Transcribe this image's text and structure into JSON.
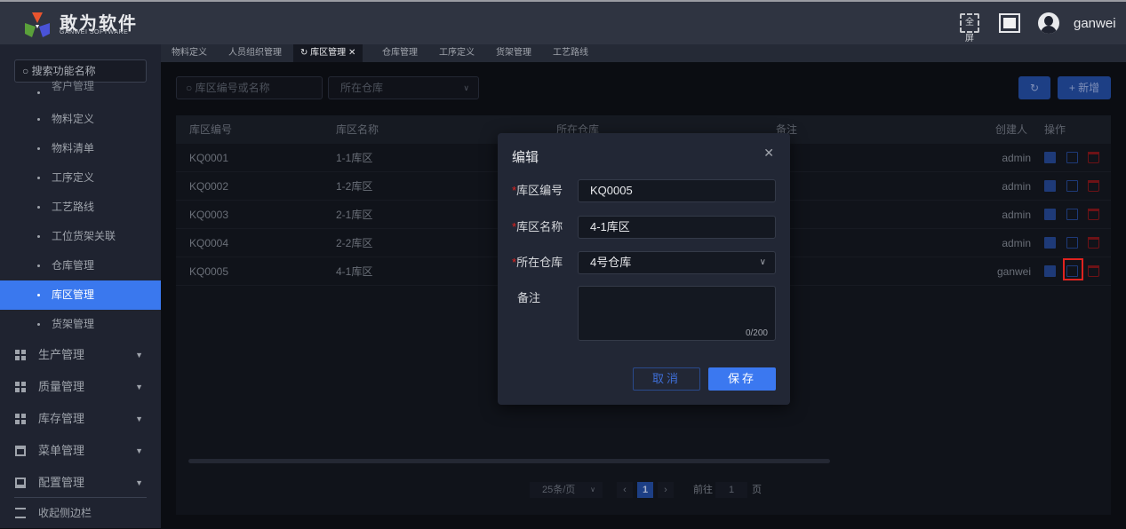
{
  "header": {
    "brand": "敢为软件",
    "brand_sub": "GANWEI SOFTWARE",
    "fullscreen_label": "全屏",
    "username": "ganwei"
  },
  "sidebar": {
    "search_placeholder": "搜索功能名称",
    "items": [
      {
        "label": "客户管理"
      },
      {
        "label": "物料定义"
      },
      {
        "label": "物料清单"
      },
      {
        "label": "工序定义"
      },
      {
        "label": "工艺路线"
      },
      {
        "label": "工位货架关联"
      },
      {
        "label": "仓库管理"
      },
      {
        "label": "库区管理",
        "active": true
      },
      {
        "label": "货架管理"
      }
    ],
    "groups": [
      {
        "label": "生产管理"
      },
      {
        "label": "质量管理"
      },
      {
        "label": "库存管理"
      },
      {
        "label": "菜单管理"
      },
      {
        "label": "配置管理"
      }
    ],
    "collapse_label": "收起侧边栏"
  },
  "tabs": [
    {
      "label": "物料定义"
    },
    {
      "label": "人员组织管理"
    },
    {
      "label": "库区管理",
      "active": true
    },
    {
      "label": "仓库管理"
    },
    {
      "label": "工序定义"
    },
    {
      "label": "货架管理"
    },
    {
      "label": "工艺路线"
    }
  ],
  "toolbar": {
    "search_placeholder": "库区编号或名称",
    "warehouse_placeholder": "所在仓库",
    "add_label": "+ 新增"
  },
  "table": {
    "columns": [
      "库区编号",
      "库区名称",
      "所在仓库",
      "备注",
      "创建人",
      "操作"
    ],
    "rows": [
      {
        "code": "KQ0001",
        "name": "1-1库区",
        "creator": "admin"
      },
      {
        "code": "KQ0002",
        "name": "1-2库区",
        "creator": "admin"
      },
      {
        "code": "KQ0003",
        "name": "2-1库区",
        "creator": "admin"
      },
      {
        "code": "KQ0004",
        "name": "2-2库区",
        "creator": "admin"
      },
      {
        "code": "KQ0005",
        "name": "4-1库区",
        "creator": "ganwei"
      }
    ]
  },
  "pagination": {
    "page_size": "25条/页",
    "current": "1",
    "goto_prefix": "前往",
    "goto_value": "1",
    "goto_suffix": "页"
  },
  "dialog": {
    "title": "编辑",
    "fields": {
      "code_label": "库区编号",
      "code_value": "KQ0005",
      "name_label": "库区名称",
      "name_value": "4-1库区",
      "warehouse_label": "所在仓库",
      "warehouse_value": "4号仓库",
      "remark_label": "备注",
      "remark_counter": "0/200"
    },
    "required_mark": "*",
    "cancel_label": "取消",
    "save_label": "保存"
  }
}
